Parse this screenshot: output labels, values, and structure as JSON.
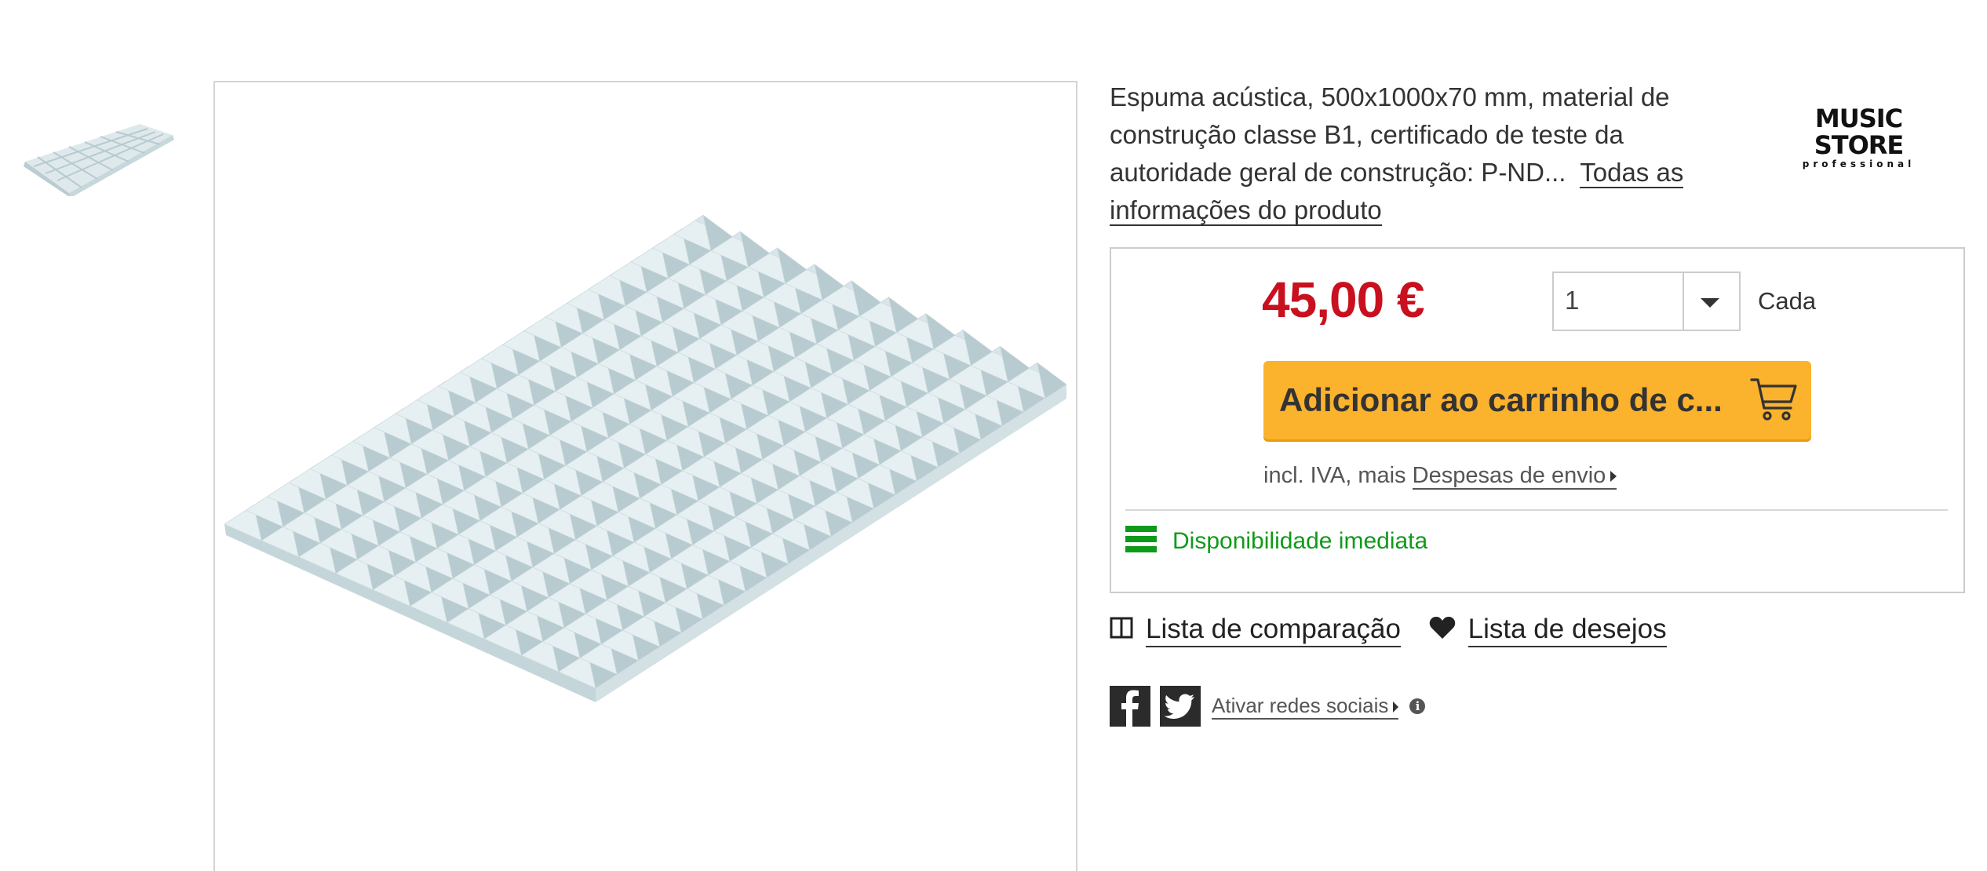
{
  "product": {
    "description": "Espuma acústica, 500x1000x70 mm, material de construção classe B1, certificado de teste da autoridade geral de construção: P-ND...",
    "more_info_link": "Todas as informações do produto",
    "brand": {
      "name": "MUSIC STORE",
      "sub": "professional"
    }
  },
  "buybox": {
    "price": "45,00 €",
    "quantity": "1",
    "unit": "Cada",
    "add_to_cart": "Adicionar ao carrinho de c...",
    "tax_prefix": "incl. IVA, mais",
    "shipping_link": "Despesas de envio",
    "availability": "Disponibilidade imediata"
  },
  "actions": {
    "compare": "Lista de comparação",
    "wishlist": "Lista de desejos"
  },
  "social": {
    "activate": "Ativar redes sociais"
  },
  "colors": {
    "price": "#c8101f",
    "cart_button": "#fbb22c",
    "availability": "#0f9a1a"
  }
}
